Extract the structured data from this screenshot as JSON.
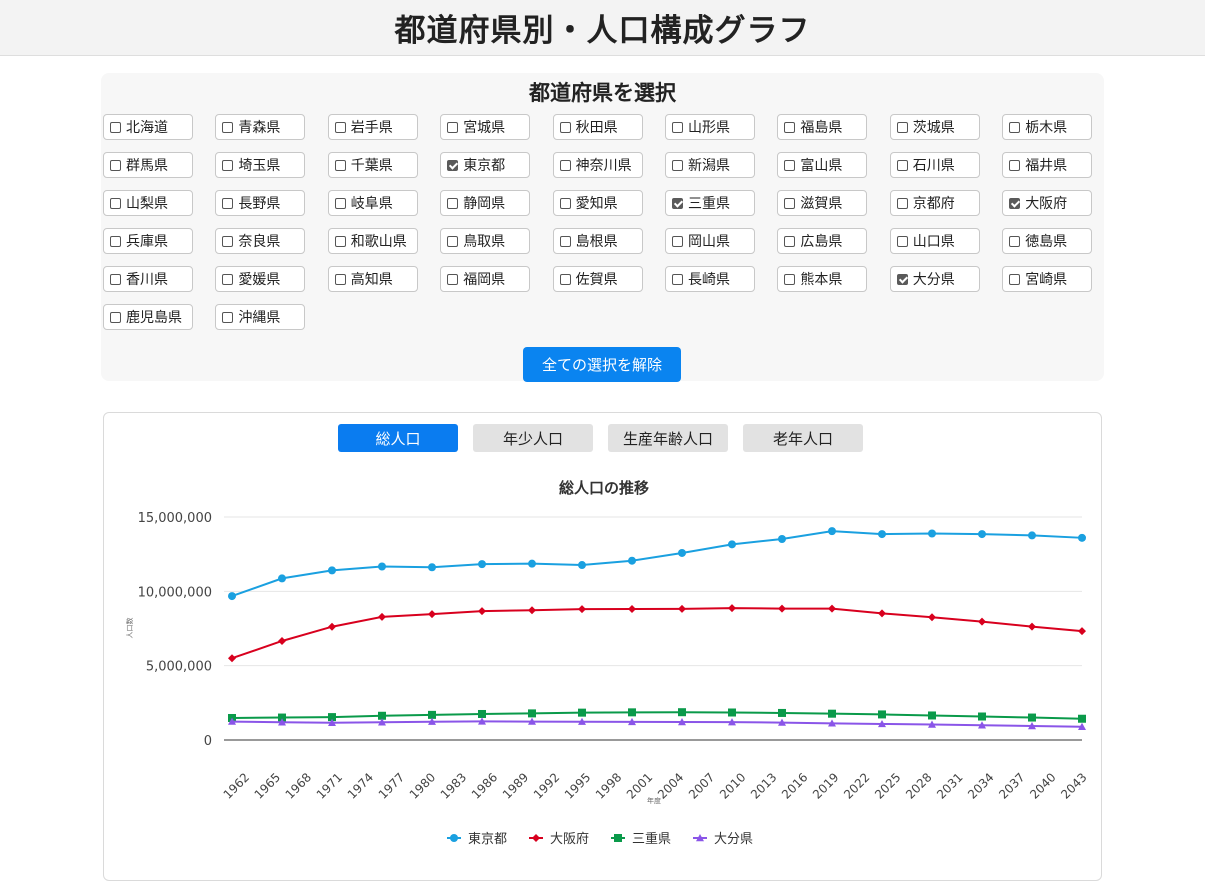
{
  "header": {
    "title": "都道府県別・人口構成グラフ"
  },
  "prefecture_selector": {
    "title": "都道府県を選択",
    "prefectures": [
      {
        "name": "北海道",
        "checked": false
      },
      {
        "name": "青森県",
        "checked": false
      },
      {
        "name": "岩手県",
        "checked": false
      },
      {
        "name": "宮城県",
        "checked": false
      },
      {
        "name": "秋田県",
        "checked": false
      },
      {
        "name": "山形県",
        "checked": false
      },
      {
        "name": "福島県",
        "checked": false
      },
      {
        "name": "茨城県",
        "checked": false
      },
      {
        "name": "栃木県",
        "checked": false
      },
      {
        "name": "群馬県",
        "checked": false
      },
      {
        "name": "埼玉県",
        "checked": false
      },
      {
        "name": "千葉県",
        "checked": false
      },
      {
        "name": "東京都",
        "checked": true
      },
      {
        "name": "神奈川県",
        "checked": false
      },
      {
        "name": "新潟県",
        "checked": false
      },
      {
        "name": "富山県",
        "checked": false
      },
      {
        "name": "石川県",
        "checked": false
      },
      {
        "name": "福井県",
        "checked": false
      },
      {
        "name": "山梨県",
        "checked": false
      },
      {
        "name": "長野県",
        "checked": false
      },
      {
        "name": "岐阜県",
        "checked": false
      },
      {
        "name": "静岡県",
        "checked": false
      },
      {
        "name": "愛知県",
        "checked": false
      },
      {
        "name": "三重県",
        "checked": true
      },
      {
        "name": "滋賀県",
        "checked": false
      },
      {
        "name": "京都府",
        "checked": false
      },
      {
        "name": "大阪府",
        "checked": true
      },
      {
        "name": "兵庫県",
        "checked": false
      },
      {
        "name": "奈良県",
        "checked": false
      },
      {
        "name": "和歌山県",
        "checked": false
      },
      {
        "name": "鳥取県",
        "checked": false
      },
      {
        "name": "島根県",
        "checked": false
      },
      {
        "name": "岡山県",
        "checked": false
      },
      {
        "name": "広島県",
        "checked": false
      },
      {
        "name": "山口県",
        "checked": false
      },
      {
        "name": "徳島県",
        "checked": false
      },
      {
        "name": "香川県",
        "checked": false
      },
      {
        "name": "愛媛県",
        "checked": false
      },
      {
        "name": "高知県",
        "checked": false
      },
      {
        "name": "福岡県",
        "checked": false
      },
      {
        "name": "佐賀県",
        "checked": false
      },
      {
        "name": "長崎県",
        "checked": false
      },
      {
        "name": "熊本県",
        "checked": false
      },
      {
        "name": "大分県",
        "checked": true
      },
      {
        "name": "宮崎県",
        "checked": false
      },
      {
        "name": "鹿児島県",
        "checked": false
      },
      {
        "name": "沖縄県",
        "checked": false
      }
    ],
    "clear_button_label": "全ての選択を解除"
  },
  "tabs": [
    {
      "label": "総人口",
      "active": true
    },
    {
      "label": "年少人口",
      "active": false
    },
    {
      "label": "生産年齢人口",
      "active": false
    },
    {
      "label": "老年人口",
      "active": false
    }
  ],
  "colors": {
    "accent": "#0a84f0",
    "tokyo": "#1aa0e0",
    "osaka": "#d8001e",
    "mie": "#0a9a4a",
    "oita": "#8a55e8"
  },
  "chart_data": {
    "type": "line",
    "title": "総人口の推移",
    "xlabel": "年度",
    "ylabel": "人口数",
    "ylim": [
      0,
      15000000
    ],
    "yticks": [
      0,
      5000000,
      10000000,
      15000000
    ],
    "ytick_labels": [
      "0",
      "5,000,000",
      "10,000,000",
      "15,000,000"
    ],
    "x_tick_labels": [
      "1962",
      "1965",
      "1968",
      "1971",
      "1974",
      "1977",
      "1980",
      "1983",
      "1986",
      "1989",
      "1992",
      "1995",
      "1998",
      "2001",
      "2004",
      "2007",
      "2010",
      "2013",
      "2016",
      "2019",
      "2022",
      "2025",
      "2028",
      "2031",
      "2034",
      "2037",
      "2040",
      "2043"
    ],
    "x": [
      1960,
      1965,
      1970,
      1975,
      1980,
      1985,
      1990,
      1995,
      2000,
      2005,
      2010,
      2015,
      2020,
      2025,
      2030,
      2035,
      2040,
      2045
    ],
    "legend_position": "bottom",
    "grid": true,
    "series": [
      {
        "name": "東京都",
        "marker": "circle",
        "color": "#1aa0e0",
        "values": [
          9680000,
          10870000,
          11410000,
          11670000,
          11620000,
          11830000,
          11860000,
          11770000,
          12060000,
          12580000,
          13160000,
          13520000,
          14050000,
          13850000,
          13890000,
          13850000,
          13760000,
          13600000
        ]
      },
      {
        "name": "大阪府",
        "marker": "diamond",
        "color": "#d8001e",
        "values": [
          5500000,
          6660000,
          7620000,
          8280000,
          8470000,
          8670000,
          8730000,
          8800000,
          8810000,
          8820000,
          8870000,
          8840000,
          8840000,
          8520000,
          8260000,
          7960000,
          7630000,
          7320000
        ]
      },
      {
        "name": "三重県",
        "marker": "square",
        "color": "#0a9a4a",
        "values": [
          1480000,
          1510000,
          1540000,
          1630000,
          1690000,
          1750000,
          1790000,
          1840000,
          1860000,
          1870000,
          1850000,
          1820000,
          1770000,
          1720000,
          1650000,
          1580000,
          1510000,
          1430000
        ]
      },
      {
        "name": "大分県",
        "marker": "triangle",
        "color": "#8a55e8",
        "values": [
          1240000,
          1190000,
          1160000,
          1190000,
          1230000,
          1250000,
          1240000,
          1230000,
          1220000,
          1210000,
          1200000,
          1170000,
          1120000,
          1080000,
          1040000,
          990000,
          940000,
          890000
        ]
      }
    ]
  }
}
